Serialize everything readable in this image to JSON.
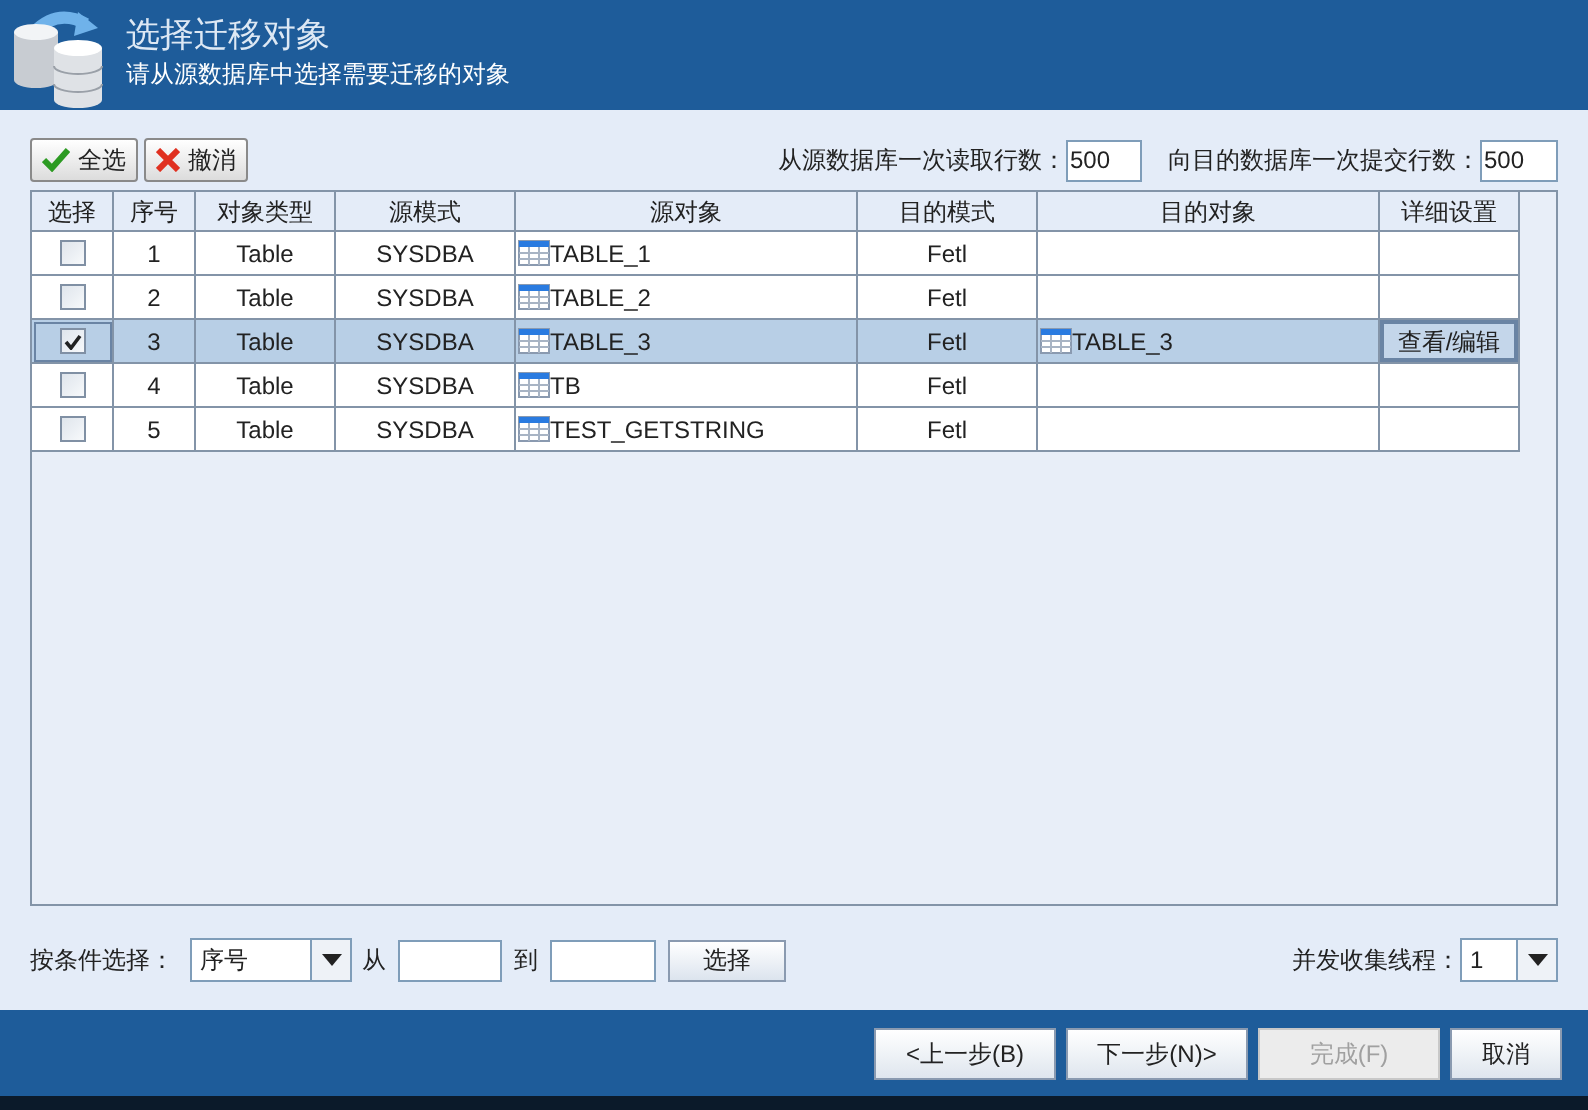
{
  "header": {
    "title": "选择迁移对象",
    "subtitle": "请从源数据库中选择需要迁移的对象"
  },
  "toolbar": {
    "select_all": "全选",
    "cancel": "撤消",
    "read_label": "从源数据库一次读取行数：",
    "read_value": "500",
    "commit_label": "向目的数据库一次提交行数：",
    "commit_value": "500"
  },
  "table": {
    "columns": [
      "选择",
      "序号",
      "对象类型",
      "源模式",
      "源对象",
      "目的模式",
      "目的对象",
      "详细设置"
    ],
    "rows": [
      {
        "checked": false,
        "selected": false,
        "index": "1",
        "type": "Table",
        "source_schema": "SYSDBA",
        "source_object": "TABLE_1",
        "target_schema": "Fetl"
      },
      {
        "checked": false,
        "selected": false,
        "index": "2",
        "type": "Table",
        "source_schema": "SYSDBA",
        "source_object": "TABLE_2",
        "target_schema": "Fetl"
      },
      {
        "checked": true,
        "selected": true,
        "index": "3",
        "type": "Table",
        "source_schema": "SYSDBA",
        "source_object": "TABLE_3",
        "target_schema": "Fetl",
        "target_object": "TABLE_3",
        "details_button": "查看/编辑"
      },
      {
        "checked": false,
        "selected": false,
        "index": "4",
        "type": "Table",
        "source_schema": "SYSDBA",
        "source_object": "TB",
        "target_schema": "Fetl"
      },
      {
        "checked": false,
        "selected": false,
        "index": "5",
        "type": "Table",
        "source_schema": "SYSDBA",
        "source_object": "TEST_GETSTRING",
        "target_schema": "Fetl"
      }
    ]
  },
  "filter": {
    "label": "按条件选择：",
    "field_value": "序号",
    "from_label": "从",
    "to_label": "到",
    "select_button": "选择",
    "threads_label": "并发收集线程：",
    "threads_value": "1"
  },
  "footer": {
    "buttons": [
      {
        "label": "<上一步(B)",
        "disabled": false
      },
      {
        "label": "下一步(N)>",
        "disabled": false
      },
      {
        "label": "完成(F)",
        "disabled": true
      },
      {
        "label": "取消",
        "disabled": false
      }
    ]
  }
}
